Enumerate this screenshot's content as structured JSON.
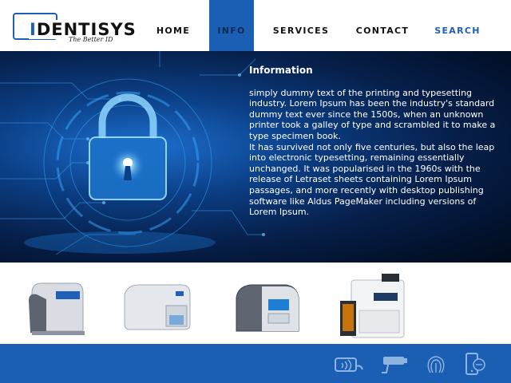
{
  "brand": {
    "wordmark_first": "I",
    "wordmark_rest": "DENTISYS",
    "tagline": "The Better ID",
    "colors": {
      "primary": "#1a5fb4",
      "text": "#111111"
    }
  },
  "nav": {
    "items": [
      {
        "label": "HOME",
        "active": false
      },
      {
        "label": "INFO",
        "active": true
      },
      {
        "label": "SERVICES",
        "active": false
      },
      {
        "label": "CONTACT",
        "active": false
      },
      {
        "label": "SEARCH",
        "active": false
      }
    ]
  },
  "hero": {
    "title": "Information",
    "paragraph1": "simply dummy text of the printing and typesetting industry. Lorem Ipsum has been the industry's standard dummy text ever since the 1500s, when an unknown printer took a galley of type and scrambled it to make a type specimen book.",
    "paragraph2": "It has survived not only five centuries, but also the leap into electronic typesetting, remaining essentially unchanged. It was popularised in the 1960s with the release of Letraset sheets containing Lorem Ipsum passages, and more recently with desktop publishing software like Aldus PageMaker including versions of Lorem Ipsum.",
    "image": "padlock-circuit-illustration"
  },
  "products": [
    {
      "icon": "card-printer-icon"
    },
    {
      "icon": "card-printer-icon"
    },
    {
      "icon": "card-printer-icon"
    },
    {
      "icon": "card-printer-icon"
    }
  ],
  "footer": {
    "icons": [
      "contactless-card-icon",
      "security-camera-icon",
      "fingerprint-icon",
      "mobile-card-icon"
    ]
  }
}
